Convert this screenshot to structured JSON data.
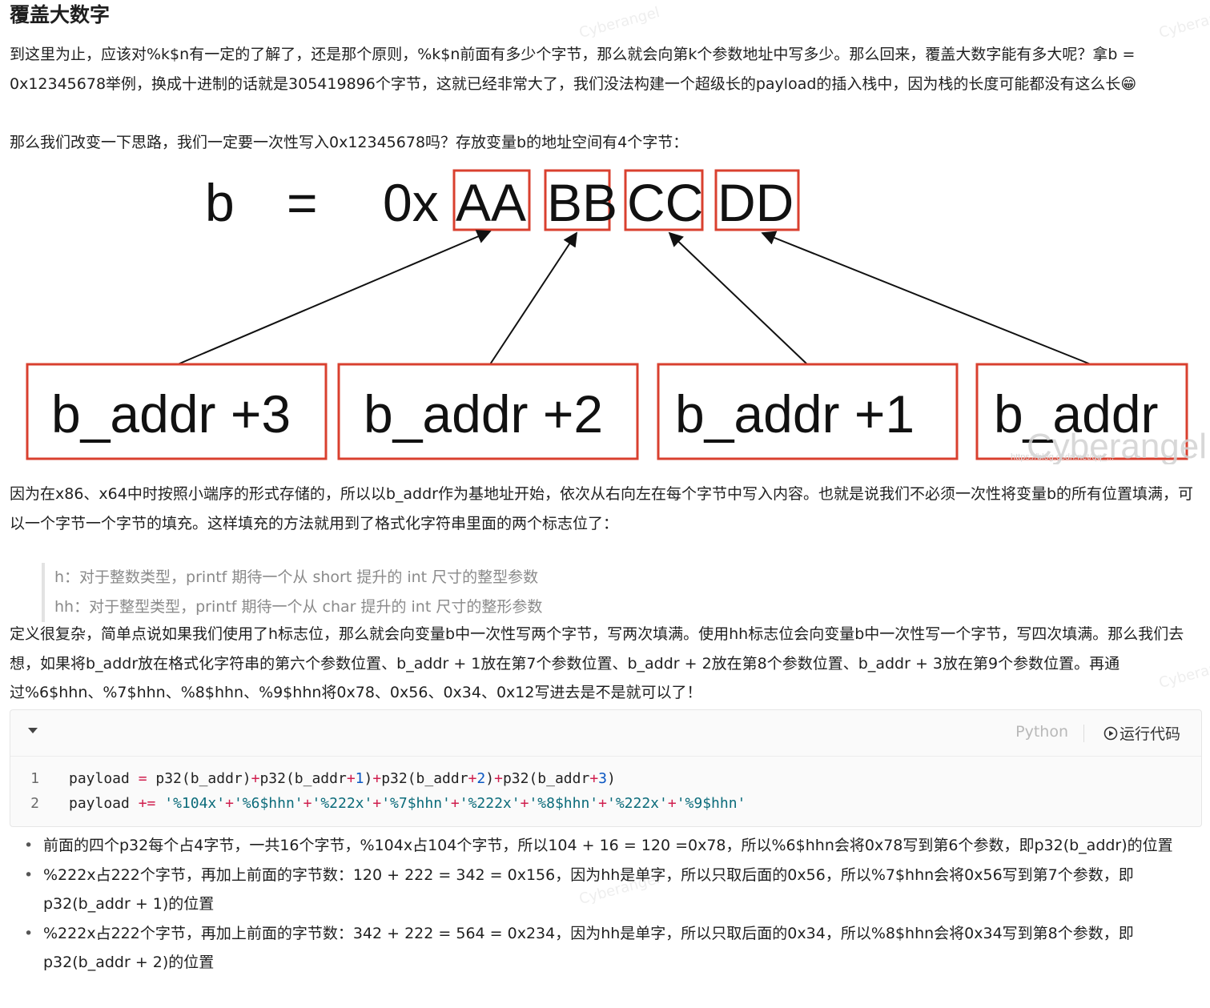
{
  "heading": "覆盖大数字",
  "para1": "到这里为止，应该对%k$n有一定的了解了，还是那个原则，%k$n前面有多少个字节，那么就会向第k个参数地址中写多少。那么回来，覆盖大数字能有多大呢？拿b = 0x12345678举例，换成十进制的话就是305419896个字节，这就已经非常大了，我们没法构建一个超级长的payload的插入栈中，因为栈的长度可能都没有这么长",
  "para1_emoji": "😁",
  "para2": "那么我们改变一下思路，我们一定要一次性写入0x12345678吗？存放变量b的地址空间有4个字节：",
  "diagram": {
    "var": "b",
    "eq": "=",
    "prefix": "0x",
    "bytes": [
      "AA",
      "BB",
      "CC",
      "DD"
    ],
    "addrs": [
      "b_addr +3",
      "b_addr +2",
      "b_addr +1",
      "b_addr"
    ],
    "watermark": "Cyberangel",
    "watermark_small": "https://blog.csdn.net/qq_..."
  },
  "para3": "因为在x86、x64中时按照小端序的形式存储的，所以以b_addr作为基地址开始，依次从右向左在每个字节中写入内容。也就是说我们不必须一次性将变量b的所有位置填满，可以一个字节一个字节的填充。这样填充的方法就用到了格式化字符串里面的两个标志位了：",
  "quote": [
    "h：对于整数类型，printf 期待一个从 short 提升的 int 尺寸的整型参数",
    "hh：对于整型类型，printf 期待一个从 char 提升的 int 尺寸的整形参数"
  ],
  "para4": "定义很复杂，简单点说如果我们使用了h标志位，那么就会向变量b中一次性写两个字节，写两次填满。使用hh标志位会向变量b中一次性写一个字节，写四次填满。那么我们去想，如果将b_addr放在格式化字符串的第六个参数位置、b_addr + 1放在第7个参数位置、b_addr + 2放在第8个参数位置、b_addr + 3放在第9个参数位置。再通过%6$hhn、%7$hhn、%8$hhn、%9$hhn将0x78、0x56、0x34、0x12写进去是不是就可以了！",
  "code": {
    "language": "Python",
    "run_label": "运行代码",
    "lines": [
      {
        "num": "1",
        "tokens": [
          {
            "t": "payload ",
            "c": "id"
          },
          {
            "t": "=",
            "c": "op"
          },
          {
            "t": " p32(b_addr)",
            "c": "id"
          },
          {
            "t": "+",
            "c": "op"
          },
          {
            "t": "p32(b_addr",
            "c": "id"
          },
          {
            "t": "+",
            "c": "op"
          },
          {
            "t": "1",
            "c": "num"
          },
          {
            "t": ")",
            "c": "id"
          },
          {
            "t": "+",
            "c": "op"
          },
          {
            "t": "p32(b_addr",
            "c": "id"
          },
          {
            "t": "+",
            "c": "op"
          },
          {
            "t": "2",
            "c": "num"
          },
          {
            "t": ")",
            "c": "id"
          },
          {
            "t": "+",
            "c": "op"
          },
          {
            "t": "p32(b_addr",
            "c": "id"
          },
          {
            "t": "+",
            "c": "op"
          },
          {
            "t": "3",
            "c": "num"
          },
          {
            "t": ")",
            "c": "id"
          }
        ]
      },
      {
        "num": "2",
        "tokens": [
          {
            "t": "payload ",
            "c": "id"
          },
          {
            "t": "+=",
            "c": "op"
          },
          {
            "t": " ",
            "c": "id"
          },
          {
            "t": "'%104x'",
            "c": "str"
          },
          {
            "t": "+",
            "c": "op"
          },
          {
            "t": "'%6$hhn'",
            "c": "str"
          },
          {
            "t": "+",
            "c": "op"
          },
          {
            "t": "'%222x'",
            "c": "str"
          },
          {
            "t": "+",
            "c": "op"
          },
          {
            "t": "'%7$hhn'",
            "c": "str"
          },
          {
            "t": "+",
            "c": "op"
          },
          {
            "t": "'%222x'",
            "c": "str"
          },
          {
            "t": "+",
            "c": "op"
          },
          {
            "t": "'%8$hhn'",
            "c": "str"
          },
          {
            "t": "+",
            "c": "op"
          },
          {
            "t": "'%222x'",
            "c": "str"
          },
          {
            "t": "+",
            "c": "op"
          },
          {
            "t": "'%9$hhn'",
            "c": "str"
          }
        ]
      }
    ]
  },
  "bullets": [
    "前面的四个p32每个占4字节，一共16个字节，%104x占104个字节，所以104 + 16 = 120 =0x78，所以%6$hhn会将0x78写到第6个参数，即p32(b_addr)的位置",
    "%222x占222个字节，再加上前面的字节数：120 + 222 = 342 = 0x156，因为hh是单字，所以只取后面的0x56，所以%7$hhn会将0x56写到第7个参数，即p32(b_addr + 1)的位置",
    "%222x占222个字节，再加上前面的字节数：342 + 222 = 564 = 0x234，因为hh是单字，所以只取后面的0x34，所以%8$hhn会将0x34写到第8个参数，即p32(b_addr + 2)的位置"
  ],
  "colors": {
    "box_red": "#d9402f",
    "code_op": "#d01f4e",
    "code_num": "#0a56c2",
    "code_str": "#0b6b7a"
  }
}
